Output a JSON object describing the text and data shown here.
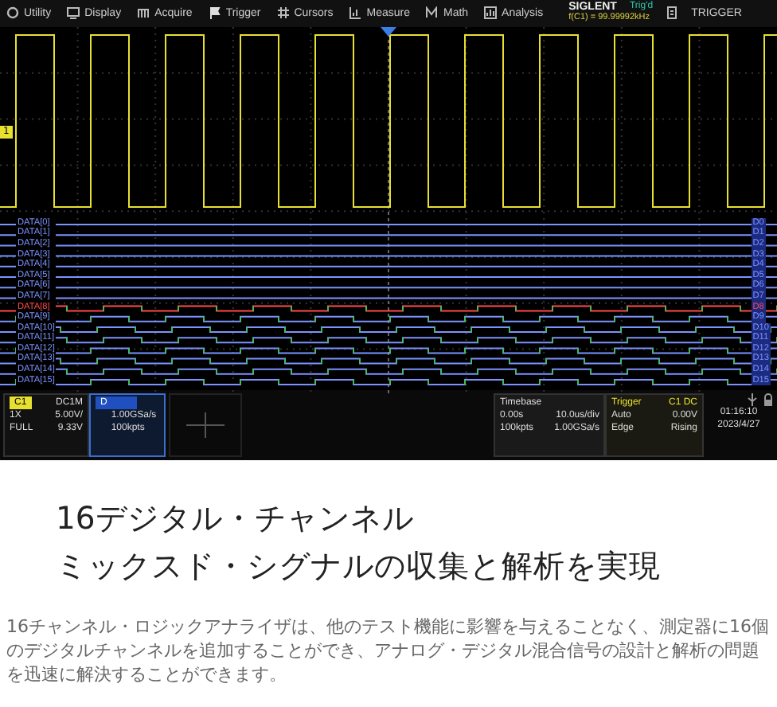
{
  "menu": [
    {
      "label": "Utility"
    },
    {
      "label": "Display"
    },
    {
      "label": "Acquire"
    },
    {
      "label": "Trigger"
    },
    {
      "label": "Cursors"
    },
    {
      "label": "Measure"
    },
    {
      "label": "Math"
    },
    {
      "label": "Analysis"
    }
  ],
  "brand": "SIGLENT",
  "trigger_state": "Trig'd",
  "frequency": "f(C1) = 99.99992kHz",
  "trigger_menu": "TRIGGER",
  "waveform": {
    "channel_marker": "1",
    "digital_channels": [
      {
        "label": "DATA[0]",
        "short": "D0",
        "color": "#7b93ff",
        "kind": "static"
      },
      {
        "label": "DATA[1]",
        "short": "D1",
        "color": "#7b93ff",
        "kind": "static"
      },
      {
        "label": "DATA[2]",
        "short": "D2",
        "color": "#7b93ff",
        "kind": "static"
      },
      {
        "label": "DATA[3]",
        "short": "D3",
        "color": "#7b93ff",
        "kind": "static"
      },
      {
        "label": "DATA[4]",
        "short": "D4",
        "color": "#7b93ff",
        "kind": "static"
      },
      {
        "label": "DATA[5]",
        "short": "D5",
        "color": "#7b93ff",
        "kind": "static"
      },
      {
        "label": "DATA[6]",
        "short": "D6",
        "color": "#7b93ff",
        "kind": "static"
      },
      {
        "label": "DATA[7]",
        "short": "D7",
        "color": "#7b93ff",
        "kind": "static"
      },
      {
        "label": "DATA[8]",
        "short": "D8",
        "color": "#ff4a4a",
        "kind": "toggling"
      },
      {
        "label": "DATA[9]",
        "short": "D9",
        "color": "#7b93ff",
        "kind": "toggling"
      },
      {
        "label": "DATA[10]",
        "short": "D10",
        "color": "#7b93ff",
        "kind": "toggling"
      },
      {
        "label": "DATA[11]",
        "short": "D11",
        "color": "#7b93ff",
        "kind": "toggling"
      },
      {
        "label": "DATA[12]",
        "short": "D12",
        "color": "#7b93ff",
        "kind": "toggling"
      },
      {
        "label": "DATA[13]",
        "short": "D13",
        "color": "#7b93ff",
        "kind": "toggling"
      },
      {
        "label": "DATA[14]",
        "short": "D14",
        "color": "#7b93ff",
        "kind": "toggling"
      },
      {
        "label": "DATA[15]",
        "short": "D15",
        "color": "#7b93ff",
        "kind": "toggling"
      }
    ]
  },
  "status": {
    "c1": {
      "label": "C1",
      "coupling": "DC1M",
      "probe": "1X",
      "scale": "5.00V/",
      "bandwidth": "FULL",
      "offset": "9.33V"
    },
    "digital": {
      "label": "D",
      "rate": "1.00GSa/s",
      "points": "100kpts"
    },
    "timebase": {
      "title": "Timebase",
      "delay": "0.00s",
      "scale": "10.0us/div",
      "points": "100kpts",
      "rate": "1.00GSa/s"
    },
    "trigger": {
      "title": "Trigger",
      "source": "C1 DC",
      "mode": "Auto",
      "level": "0.00V",
      "type": "Edge",
      "slope": "Rising"
    },
    "clock": {
      "time": "01:16:10",
      "date": "2023/4/27"
    }
  },
  "heading": [
    "16デジタル・チャンネル",
    "ミックスド・シグナルの収集と解析を実現"
  ],
  "paragraph": "16チャンネル・ロジックアナライザは、他のテスト機能に影響を与えることなく、測定器に16個のデジタルチャンネルを追加することができ、アナログ・デジタル混合信号の設計と解析の問題を迅速に解決することができます。"
}
